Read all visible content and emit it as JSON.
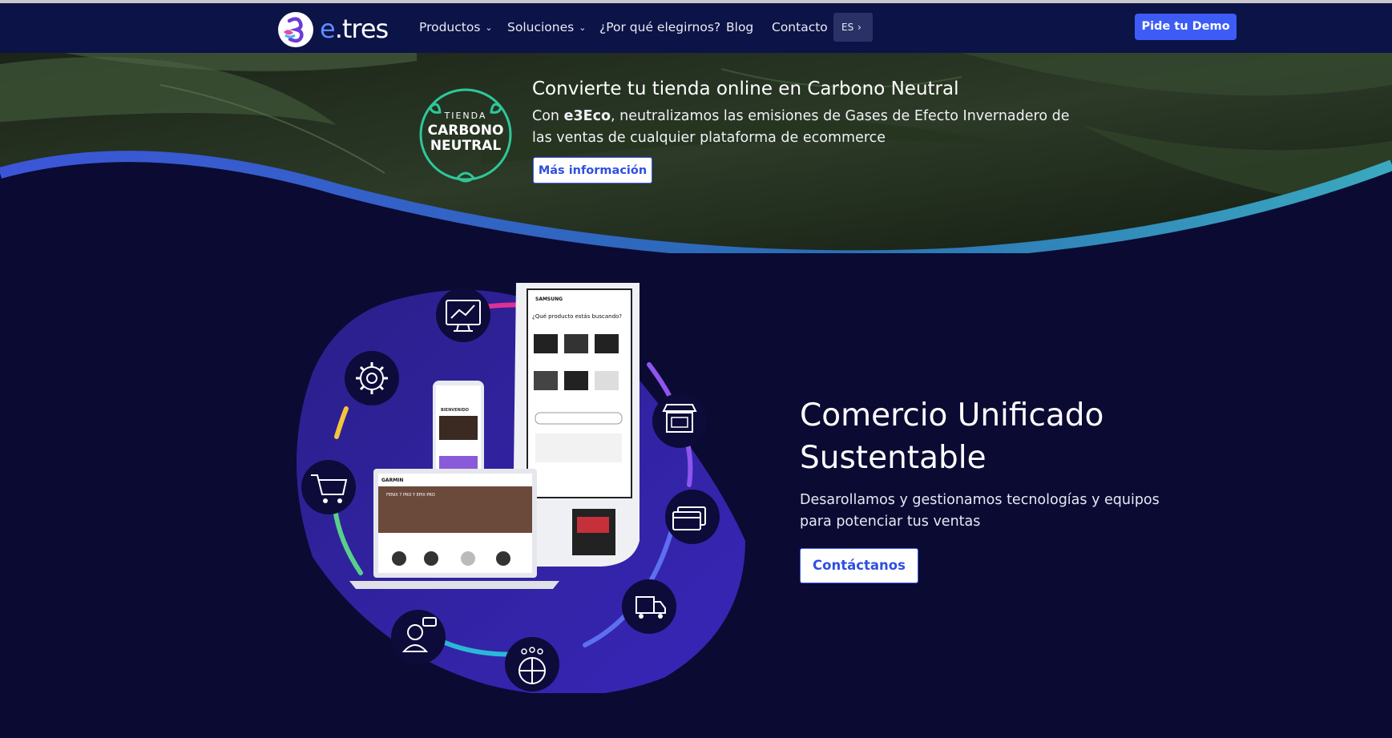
{
  "nav": {
    "logo_text_e": "e",
    "logo_text_rest": ".tres",
    "items": [
      {
        "label": "Productos",
        "has_dropdown": true
      },
      {
        "label": "Soluciones",
        "has_dropdown": true
      },
      {
        "label": "¿Por qué elegirnos?",
        "has_dropdown": false
      },
      {
        "label": "Blog",
        "has_dropdown": false
      },
      {
        "label": "Contacto",
        "has_dropdown": false
      }
    ],
    "language": "ES",
    "demo_button": "Pide tu Demo"
  },
  "banner": {
    "badge_top": "TIENDA",
    "badge_line1": "CARBONO",
    "badge_line2": "NEUTRAL",
    "title": "Convierte tu tienda online en Carbono Neutral",
    "text_prefix": "Con ",
    "text_bold": "e3Eco",
    "text_rest": ", neutralizamos las emisiones de Gases de Efecto Invernadero de las ventas de cualquier plataforma de ecommerce",
    "button": "Más información"
  },
  "hero": {
    "title": "Comercio Unificado Sustentable",
    "text": "Desarollamos y gestionamos tecnologías y equipos para potenciar tus ventas",
    "button": "Contáctanos",
    "kiosk_brand": "SAMSUNG",
    "kiosk_question": "¿Qué producto estás buscando?",
    "laptop_brand": "GARMIN",
    "laptop_headline": "FENIX 7 PRO Y EPIX PRO",
    "phone_banner": "BIENVENIDO"
  },
  "colors": {
    "nav_bg": "#0c1346",
    "page_bg": "#0b0a33",
    "accent": "#3d5cf5"
  }
}
